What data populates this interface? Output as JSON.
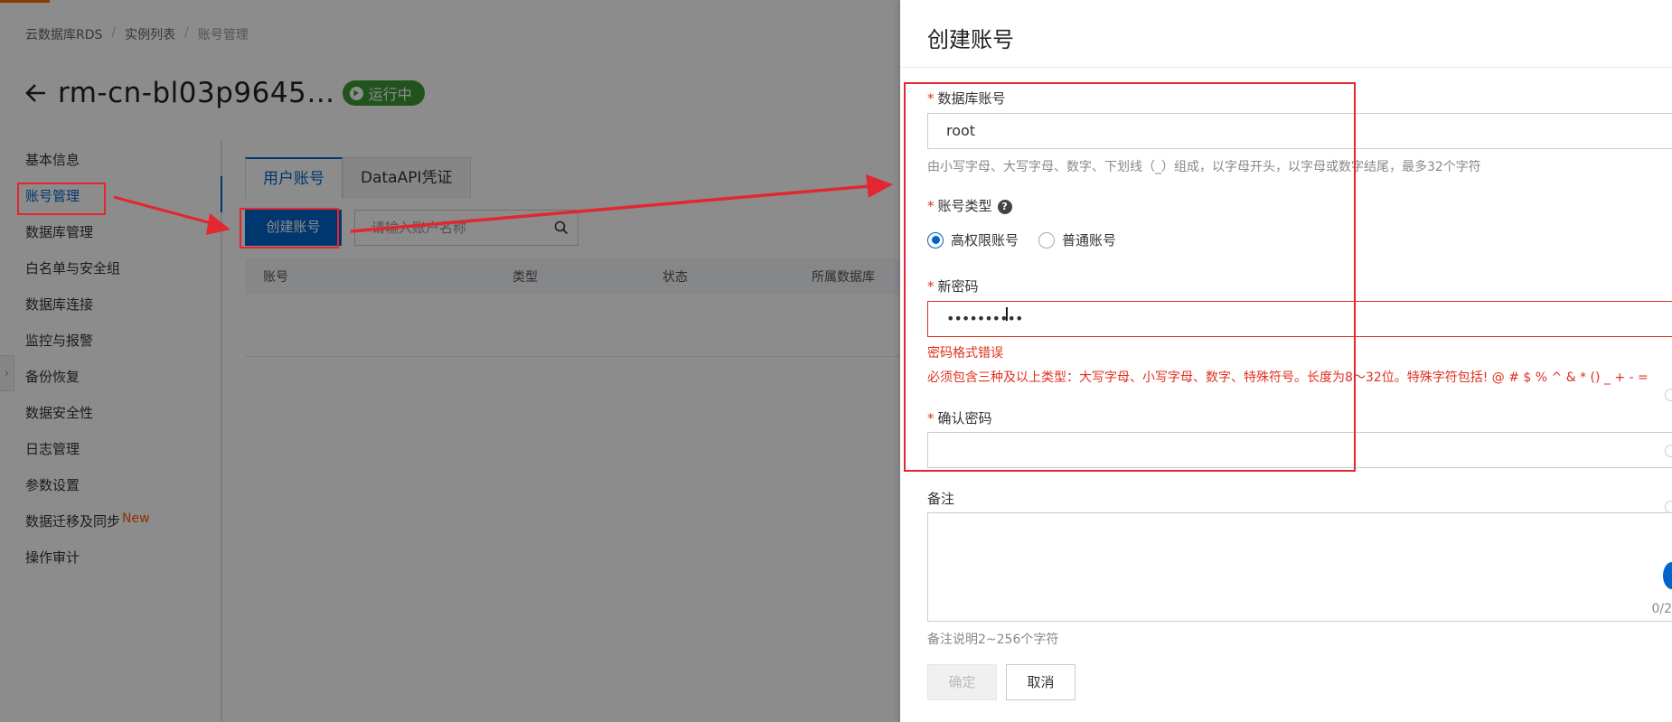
{
  "breadcrumb": [
    "云数据库RDS",
    "实例列表",
    "账号管理"
  ],
  "instance": {
    "title": "rm-cn-bl03p9645…",
    "status": "运行中"
  },
  "nav": {
    "items": [
      {
        "label": "基本信息"
      },
      {
        "label": "账号管理"
      },
      {
        "label": "数据库管理"
      },
      {
        "label": "白名单与安全组"
      },
      {
        "label": "数据库连接"
      },
      {
        "label": "监控与报警"
      },
      {
        "label": "备份恢复"
      },
      {
        "label": "数据安全性"
      },
      {
        "label": "日志管理"
      },
      {
        "label": "参数设置"
      },
      {
        "label": "数据迁移及同步",
        "badge": "New"
      },
      {
        "label": "操作审计"
      }
    ]
  },
  "tabs": [
    "用户账号",
    "DataAPI凭证"
  ],
  "toolbar": {
    "create_label": "创建账号",
    "search_placeholder": "请输入账户名称"
  },
  "table": {
    "columns": [
      "账号",
      "类型",
      "状态",
      "所属数据库"
    ]
  },
  "drawer": {
    "title": "创建账号",
    "account": {
      "label": "数据库账号",
      "value": "root",
      "hint": "由小写字母、大写字母、数字、下划线（_）组成，以字母开头，以字母或数字结尾，最多32个字符"
    },
    "account_type": {
      "label": "账号类型",
      "options": [
        "高权限账号",
        "普通账号"
      ],
      "selected": "高权限账号"
    },
    "new_password": {
      "label": "新密码",
      "masked_value": "••••••••••",
      "error_title": "密码格式错误",
      "error_detail": "必须包含三种及以上类型：大写字母、小写字母、数字、特殊符号。长度为8～32位。特殊字符包括! @ # $ % ^ & * () _ + - ="
    },
    "confirm_password": {
      "label": "确认密码",
      "value": ""
    },
    "remark": {
      "label": "备注",
      "counter": "0/2",
      "hint": "备注说明2~256个字符"
    },
    "buttons": {
      "confirm": "确定",
      "cancel": "取消"
    }
  },
  "colors": {
    "primary": "#0064c8",
    "status_green": "#3d9a34",
    "error_red": "#e0301e",
    "annotation_red": "#e3262f"
  }
}
